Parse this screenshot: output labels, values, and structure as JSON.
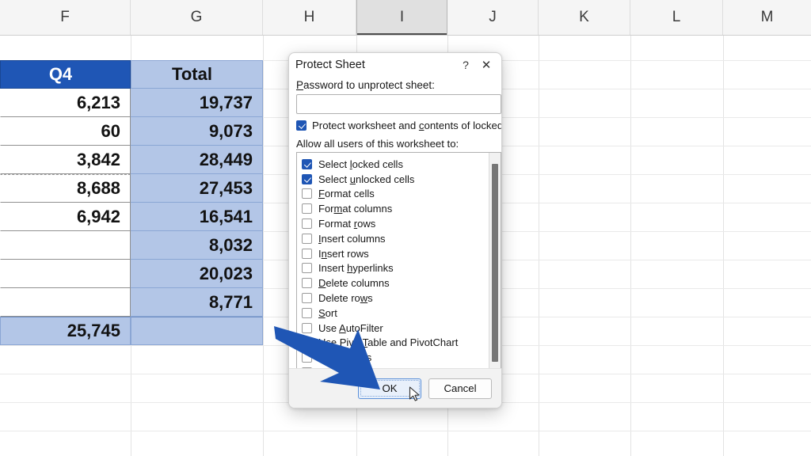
{
  "spreadsheet": {
    "column_headers": [
      "F",
      "G",
      "H",
      "I",
      "J",
      "K",
      "L",
      "M"
    ],
    "selected_column": "I",
    "table": {
      "headers": [
        "Q4",
        "Total"
      ],
      "rows": [
        {
          "q4": "6,213",
          "total": "19,737"
        },
        {
          "q4": "60",
          "total": "9,073"
        },
        {
          "q4": "3,842",
          "total": "28,449"
        },
        {
          "q4": "8,688",
          "total": "27,453"
        },
        {
          "q4": "6,942",
          "total": "16,541"
        },
        {
          "q4": "",
          "total": "8,032"
        },
        {
          "q4": "",
          "total": "20,023"
        },
        {
          "q4": "",
          "total": "8,771"
        }
      ],
      "total_row": {
        "q4": "25,745",
        "total": ""
      }
    },
    "colors": {
      "header_q4_bg": "#1f56b5",
      "header_q4_text": "#ffffff",
      "header_total_bg": "#b3c6e7",
      "cell_highlight_bg": "#b3c6e7"
    }
  },
  "dialog": {
    "title": "Protect Sheet",
    "help_icon": "?",
    "close_icon": "✕",
    "password_label": "Password to unprotect sheet:",
    "password_value": "",
    "password_placeholder": "",
    "protect_checkbox": {
      "label": "Protect worksheet and contents of locked cells",
      "checked": true
    },
    "allow_label": "Allow all users of this worksheet to:",
    "permissions": [
      {
        "label": "Select locked cells",
        "checked": true
      },
      {
        "label": "Select unlocked cells",
        "checked": true
      },
      {
        "label": "Format cells",
        "checked": false
      },
      {
        "label": "Format columns",
        "checked": false
      },
      {
        "label": "Format rows",
        "checked": false
      },
      {
        "label": "Insert columns",
        "checked": false
      },
      {
        "label": "Insert rows",
        "checked": false
      },
      {
        "label": "Insert hyperlinks",
        "checked": false
      },
      {
        "label": "Delete columns",
        "checked": false
      },
      {
        "label": "Delete rows",
        "checked": false
      },
      {
        "label": "Sort",
        "checked": false
      },
      {
        "label": "Use AutoFilter",
        "checked": false
      },
      {
        "label": "Use PivotTable and PivotChart",
        "checked": false
      },
      {
        "label": "Edit objects",
        "checked": false
      },
      {
        "label": "Edit scenarios",
        "checked": false
      }
    ],
    "buttons": {
      "ok": "OK",
      "cancel": "Cancel"
    }
  },
  "annotation": {
    "arrow_color": "#1f56b5",
    "points_to": "OK"
  }
}
